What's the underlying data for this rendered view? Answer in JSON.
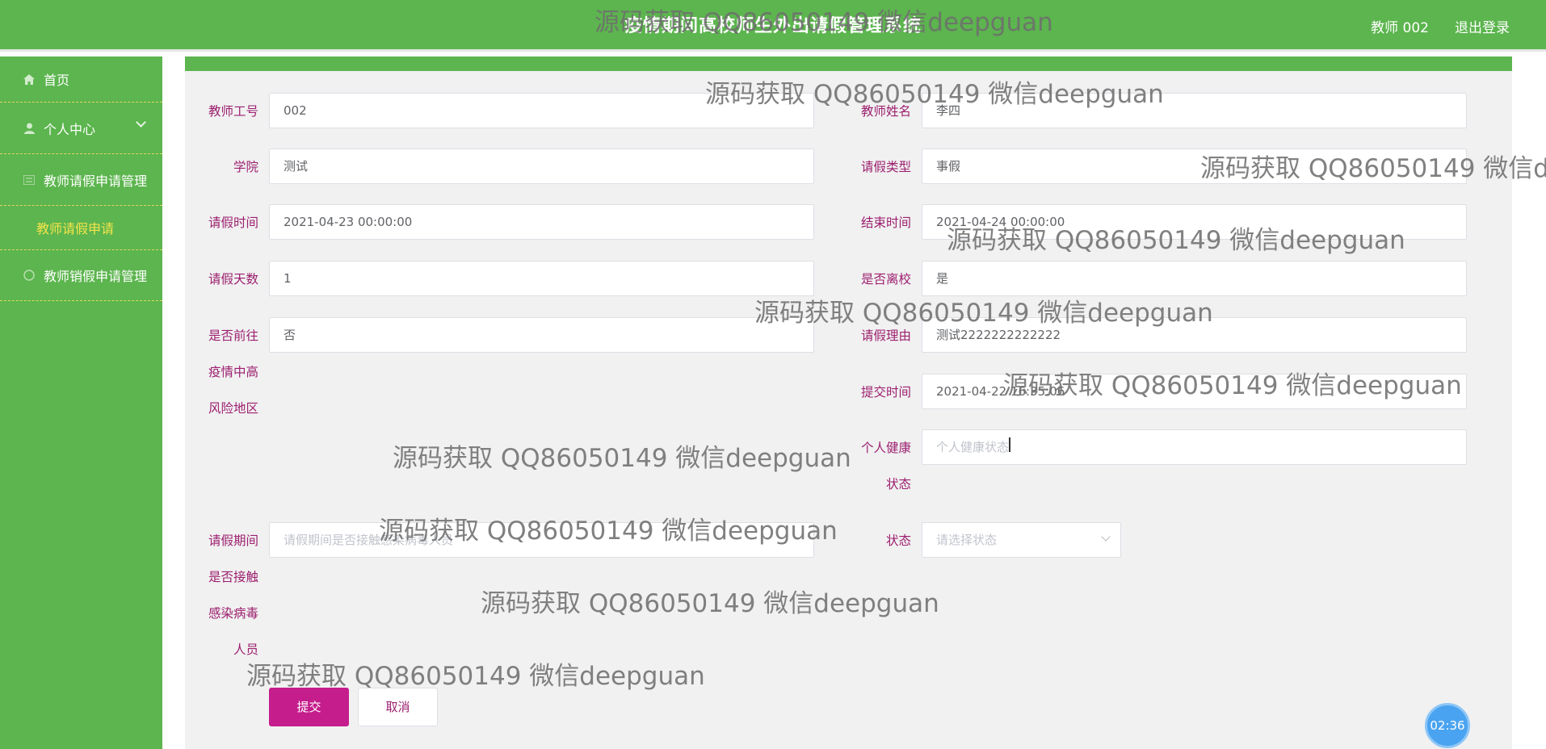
{
  "header": {
    "title": "疫情期间高校师生外出请假管理系统",
    "user": "教师 002",
    "logout": "退出登录"
  },
  "sidebar": {
    "home": "首页",
    "personal": "个人中心",
    "leave_mgmt": "教师请假申请管理",
    "leave_apply": "教师请假申请",
    "cancel_mgmt": "教师销假申请管理"
  },
  "form": {
    "teacher_id": {
      "label": "教师工号",
      "value": "002"
    },
    "teacher_name": {
      "label": "教师姓名",
      "value": "李四"
    },
    "college": {
      "label": "学院",
      "value": "测试"
    },
    "leave_type": {
      "label": "请假类型",
      "value": "事假"
    },
    "leave_start": {
      "label": "请假时间",
      "value": "2021-04-23 00:00:00"
    },
    "leave_end": {
      "label": "结束时间",
      "value": "2021-04-24 00:00:00"
    },
    "leave_days": {
      "label": "请假天数",
      "value": "1"
    },
    "leave_school": {
      "label": "是否离校",
      "value": "是"
    },
    "risk_area": {
      "label_lines": [
        "是否前往",
        "疫情中高",
        "风险地区"
      ],
      "value": "否"
    },
    "reason": {
      "label": "请假理由",
      "value": "测试2222222222222"
    },
    "submit_time": {
      "label": "提交时间",
      "value": "2021-04-22 16:35:06"
    },
    "health": {
      "label_lines": [
        "个人健康",
        "状态"
      ],
      "placeholder": "个人健康状态"
    },
    "contact": {
      "label_lines": [
        "请假期间",
        "是否接触",
        "感染病毒",
        "人员"
      ],
      "placeholder": "请假期间是否接触感染病毒人员"
    },
    "status": {
      "label": "状态",
      "placeholder": "请选择状态"
    }
  },
  "buttons": {
    "submit": "提交",
    "cancel": "取消"
  },
  "timer": "02:36",
  "watermark": "源码获取 QQ86050149 微信deepguan",
  "colors": {
    "green": "#5cb54e",
    "label": "#9c1f6f",
    "primary": "#c51d8c",
    "submenu_active": "#f4e44c"
  }
}
